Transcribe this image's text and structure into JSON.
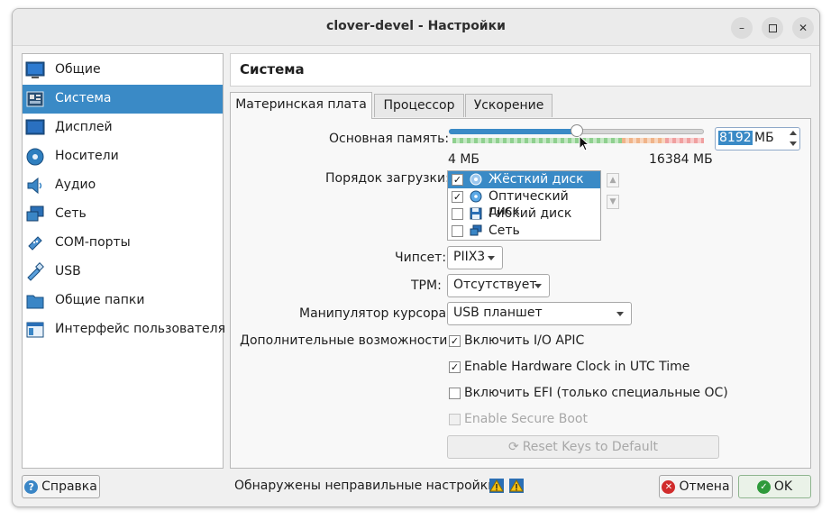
{
  "window": {
    "title": "clover-devel - Настройки"
  },
  "sidebar": {
    "items": [
      {
        "label": "Общие",
        "icon": "monitor-icon"
      },
      {
        "label": "Система",
        "icon": "motherboard-icon",
        "selected": true
      },
      {
        "label": "Дисплей",
        "icon": "display-icon"
      },
      {
        "label": "Носители",
        "icon": "storage-icon"
      },
      {
        "label": "Аудио",
        "icon": "speaker-icon"
      },
      {
        "label": "Сеть",
        "icon": "network-icon"
      },
      {
        "label": "COM-порты",
        "icon": "serial-port-icon"
      },
      {
        "label": "USB",
        "icon": "usb-icon"
      },
      {
        "label": "Общие папки",
        "icon": "folder-icon"
      },
      {
        "label": "Интерфейс пользователя",
        "icon": "ui-window-icon"
      }
    ]
  },
  "header": {
    "title": "Система"
  },
  "tabs": [
    {
      "label": "Материнская плата",
      "active": true
    },
    {
      "label": "Процессор"
    },
    {
      "label": "Ускорение"
    }
  ],
  "memory": {
    "label": "Основная память:",
    "min_label": "4 МБ",
    "max_label": "16384 МБ",
    "value": "8192",
    "unit": "МБ",
    "fraction": 0.5
  },
  "boot_order": {
    "label": "Порядок загрузки:",
    "items": [
      {
        "label": "Жёсткий диск",
        "checked": true,
        "icon": "hard-disk-icon"
      },
      {
        "label": "Оптический диск",
        "checked": true,
        "icon": "optical-disk-icon"
      },
      {
        "label": "Гибкий диск",
        "checked": false,
        "icon": "floppy-icon"
      },
      {
        "label": "Сеть",
        "checked": false,
        "icon": "network-icon"
      }
    ]
  },
  "chipset": {
    "label": "Чипсет:",
    "value": "PIIX3"
  },
  "tpm": {
    "label": "TPM:",
    "value": "Отсутствует"
  },
  "pointing": {
    "label": "Манипулятор курсора:",
    "value": "USB планшет"
  },
  "features": {
    "label": "Дополнительные возможности:",
    "io_apic": "Включить I/O APIC",
    "utc_clock": "Enable Hardware Clock in UTC Time",
    "efi": "Включить EFI (только специальные ОС)",
    "secure_boot": "Enable Secure Boot",
    "reset_keys": "Reset Keys to Default"
  },
  "footer": {
    "help": "Справка",
    "status": "Обнаружены неправильные настройки",
    "cancel": "Отмена",
    "ok": "OK"
  },
  "colors": {
    "accent": "#3a8ac6",
    "slider_fill": "#3a8ac6"
  }
}
